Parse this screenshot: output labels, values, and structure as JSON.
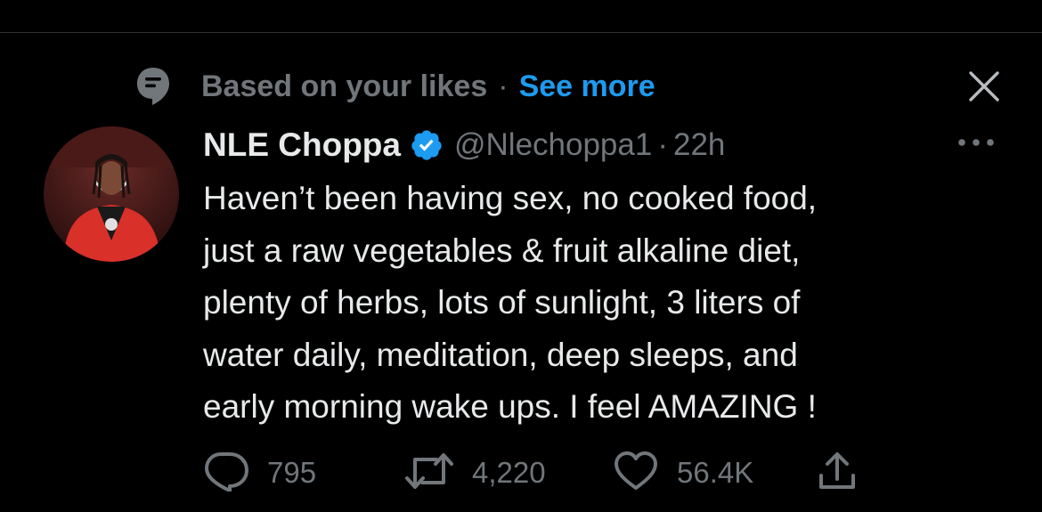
{
  "context": {
    "reason": "Based on your likes",
    "separator": "·",
    "link": "See more"
  },
  "tweet": {
    "display_name": "NLE Choppa",
    "handle": "@Nlechoppa1",
    "separator": "·",
    "time": "22h",
    "lines": [
      "Haven’t been having sex, no cooked food,",
      "just a raw vegetables & fruit alkaline diet,",
      "plenty of herbs, lots of sunlight, 3 liters of",
      "water daily, meditation, deep sleeps, and",
      "early morning wake ups. I feel AMAZING !"
    ]
  },
  "actions": {
    "replies": "795",
    "retweets": "4,220",
    "likes": "56.4K"
  },
  "icons": {
    "context": "topic-bubble-icon",
    "close": "close-icon",
    "verified": "verified-badge-icon",
    "more": "more-horizontal-icon",
    "reply": "reply-icon",
    "retweet": "retweet-icon",
    "like": "heart-icon",
    "share": "share-icon"
  },
  "colors": {
    "background": "#000000",
    "text_primary": "#e7e9ea",
    "text_secondary": "#71767b",
    "accent": "#1d9bf0"
  }
}
